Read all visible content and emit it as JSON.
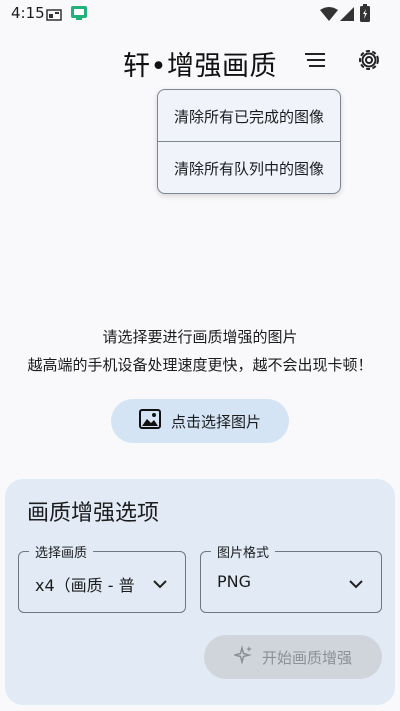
{
  "status_bar": {
    "time": "4:15"
  },
  "app": {
    "title": "轩•增强画质"
  },
  "menu": {
    "items": [
      {
        "label": "清除所有已完成的图像"
      },
      {
        "label": "清除所有队列中的图像"
      }
    ]
  },
  "hint": {
    "line1": "请选择要进行画质增强的图片",
    "line2": "越高端的手机设备处理速度更快，越不会出现卡顿！"
  },
  "pick_button": {
    "label": "点击选择图片"
  },
  "options": {
    "title": "画质增强选项",
    "quality": {
      "label": "选择画质",
      "value": "x4（画质 - 普"
    },
    "format": {
      "label": "图片格式",
      "value": "PNG"
    },
    "start_button": {
      "label": "开始画质增强"
    }
  },
  "colors": {
    "background": "#f9f9fc",
    "card": "#e2ebf5",
    "pick_button": "#d5e4f5",
    "disabled_button": "#d0d5dc",
    "menu": "#f0f3f9"
  }
}
